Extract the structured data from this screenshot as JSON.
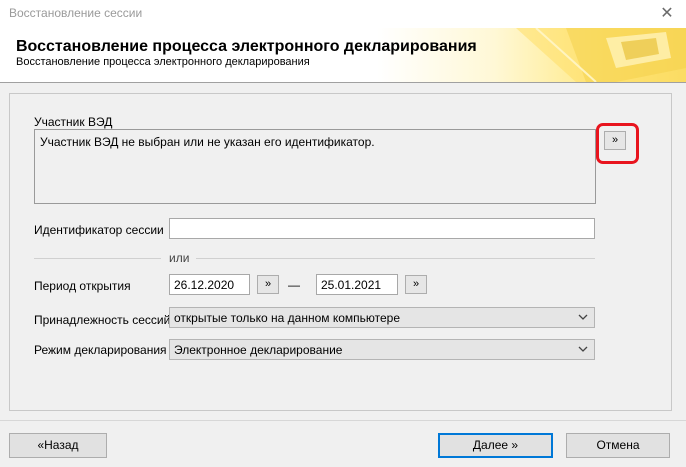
{
  "window": {
    "title": "Восстановление сессии",
    "close_glyph": "✕"
  },
  "banner": {
    "title": "Восстановление процесса электронного декларирования",
    "subtitle": "Восстановление процесса электронного декларирования"
  },
  "form": {
    "participant_label": "Участник ВЭД",
    "participant_text": "Участник ВЭД не выбран или не указан его идентификатор.",
    "participant_button": "»",
    "session_id_label": "Идентификатор сессии",
    "session_id_value": "",
    "or_label": "или",
    "period_label": "Период открытия",
    "date_from": "26.12.2020",
    "date_to": "25.01.2021",
    "date_button": "»",
    "dash": "—",
    "ownership_label": "Принадлежность сессий",
    "ownership_value": "открытые только на данном компьютере",
    "mode_label": "Режим декларирования",
    "mode_value": "Электронное декларирование"
  },
  "footer": {
    "back_label": "«Назад",
    "next_label": "Далее »",
    "cancel_label": "Отмена"
  },
  "colors": {
    "highlight": "#e8141e",
    "primary_border": "#0078d7"
  }
}
